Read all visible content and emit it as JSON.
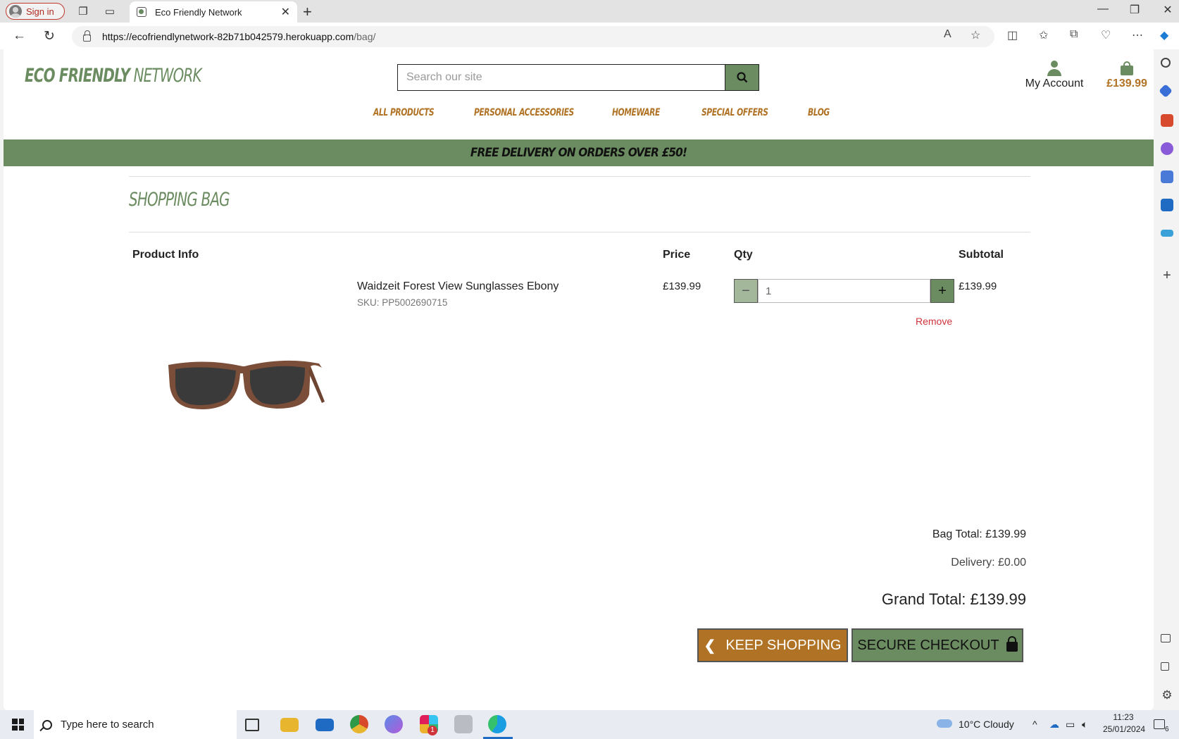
{
  "browser": {
    "signin_label": "Sign in",
    "tab_title": "Eco Friendly Network",
    "url_host": "https://ecofriendlynetwork-82b71b042579.herokuapp.com",
    "url_path": "/bag/"
  },
  "site": {
    "logo_bold": "ECO FRIENDLY",
    "logo_light": " NETWORK",
    "search_placeholder": "Search our site",
    "account_label": "My Account",
    "bag_total_nav": "£139.99",
    "menu": [
      "ALL PRODUCTS",
      "PERSONAL ACCESSORIES",
      "HOMEWARE",
      "SPECIAL OFFERS",
      "BLOG"
    ],
    "banner": "FREE DELIVERY ON ORDERS OVER £50!"
  },
  "bag": {
    "title": "SHOPPING BAG",
    "headers": {
      "product": "Product Info",
      "price": "Price",
      "qty": "Qty",
      "subtotal": "Subtotal"
    },
    "item": {
      "name": "Waidzeit Forest View Sunglasses Ebony",
      "sku": "SKU: PP5002690715",
      "price": "£139.99",
      "qty": "1",
      "subtotal": "£139.99",
      "remove": "Remove"
    },
    "bag_total": "Bag Total: £139.99",
    "delivery": "Delivery: £0.00",
    "grand_total": "Grand Total: £139.99",
    "keep_shopping": "KEEP SHOPPING",
    "secure_checkout": "SECURE CHECKOUT"
  },
  "taskbar": {
    "search_placeholder": "Type here to search",
    "weather": "10°C  Cloudy",
    "time": "11:23",
    "date": "25/01/2024",
    "notif_count": "6",
    "slack_badge": "1"
  },
  "colors": {
    "brand_green": "#6b8c60",
    "brand_orange": "#b07325",
    "remove_red": "#d0343b"
  }
}
